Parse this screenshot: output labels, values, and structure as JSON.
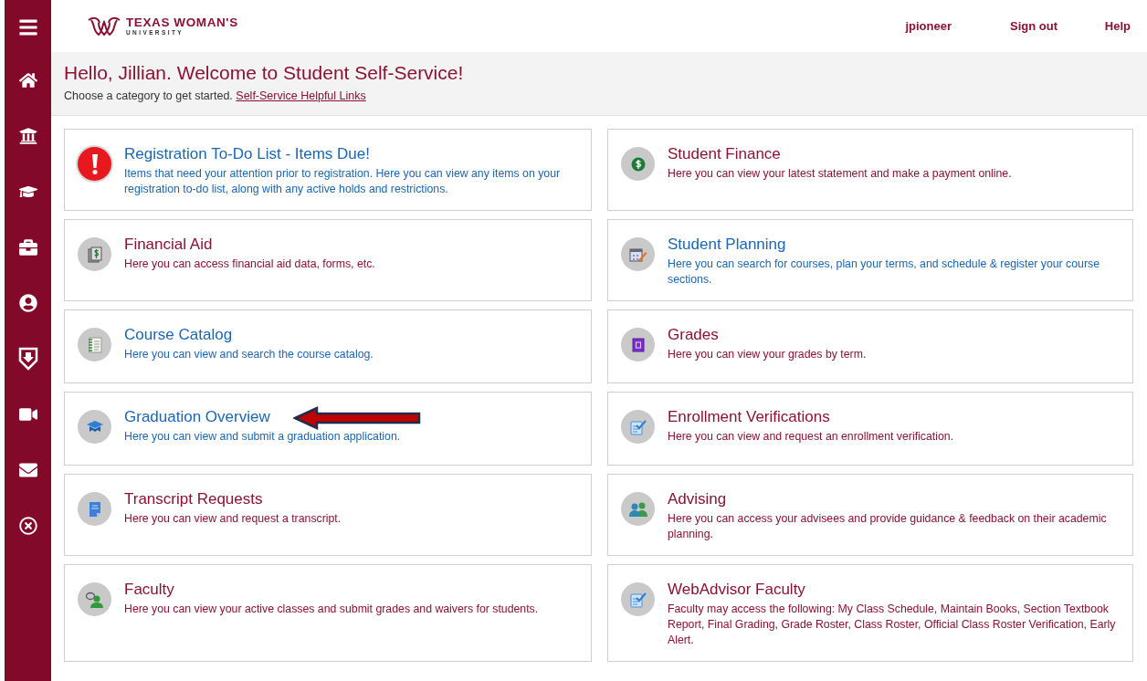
{
  "header": {
    "logo": {
      "name": "TEXAS WOMAN'S",
      "subtitle": "UNIVERSITY"
    },
    "links": [
      "jpioneer",
      "Sign out",
      "Help"
    ]
  },
  "welcome": {
    "title": "Hello, Jillian. Welcome to Student Self-Service!",
    "prompt": "Choose a category to get started.",
    "link": "Self-Service Helpful Links"
  },
  "categories": [
    {
      "title": "Registration To-Do List - Items Due!",
      "description": "Items that need your attention prior to registration. Here you can view any items on your registration to-do list, along with any active holds and restrictions.",
      "color": "#1a66b3",
      "annotated": false
    },
    {
      "title": "Student Finance",
      "description": "Here you can view your latest statement and make a payment online.",
      "color": "#8a1232",
      "annotated": false
    },
    {
      "title": "Financial Aid",
      "description": "Here you can access financial aid data, forms, etc.",
      "color": "#8a1232",
      "annotated": false
    },
    {
      "title": "Student Planning",
      "description": "Here you can search for courses, plan your terms, and schedule & register your course sections.",
      "color": "#1a66b3",
      "annotated": false
    },
    {
      "title": "Course Catalog",
      "description": "Here you can view and search the course catalog.",
      "color": "#1a66b3",
      "annotated": false
    },
    {
      "title": "Grades",
      "description": "Here you can view your grades by term.",
      "color": "#8a1232",
      "annotated": false
    },
    {
      "title": "Graduation Overview",
      "description": "Here you can view and submit a graduation application.",
      "color": "#1a66b3",
      "annotated": true
    },
    {
      "title": "Enrollment Verifications",
      "description": "Here you can view and request an enrollment verification.",
      "color": "#8a1232",
      "annotated": false
    },
    {
      "title": "Transcript Requests",
      "description": "Here you can view and request a transcript.",
      "color": "#8a1232",
      "annotated": false
    },
    {
      "title": "Advising",
      "description": "Here you can access your advisees and provide guidance & feedback on their academic planning.",
      "color": "#8a1232",
      "annotated": false
    },
    {
      "title": "Faculty",
      "description": "Here you can view your active classes and submit grades and waivers for students.",
      "color": "#8a1232",
      "annotated": false
    },
    {
      "title": "WebAdvisor Faculty",
      "description": "Faculty may access the following: My Class Schedule, Maintain Books, Section Textbook Report, Final Grading, Grade Roster, Class Roster, Official Class Roster Verification, Early Alert.",
      "color": "#8a1232",
      "annotated": false
    }
  ]
}
